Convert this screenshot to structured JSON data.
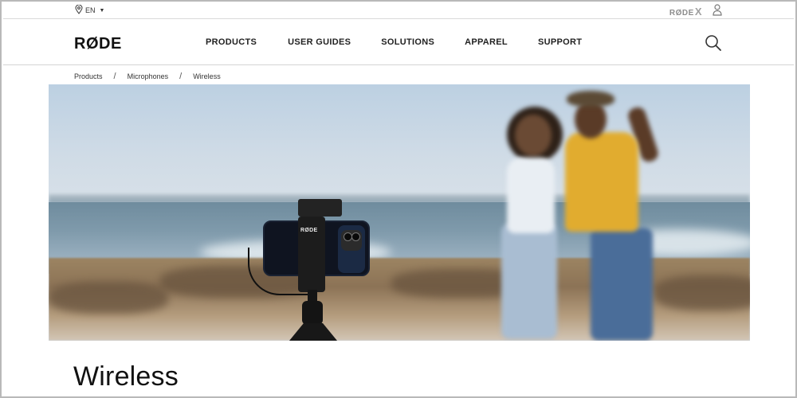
{
  "utility_bar": {
    "language": "EN",
    "rodex_label": "RØDE",
    "rodex_suffix": "X"
  },
  "brand": {
    "logo": "RØDE"
  },
  "nav": {
    "items": [
      {
        "label": "PRODUCTS"
      },
      {
        "label": "USER GUIDES"
      },
      {
        "label": "SOLUTIONS"
      },
      {
        "label": "APPAREL"
      },
      {
        "label": "SUPPORT"
      }
    ]
  },
  "breadcrumb": {
    "items": [
      {
        "label": "Products"
      },
      {
        "label": "Microphones"
      },
      {
        "label": "Wireless"
      }
    ],
    "separator": "/"
  },
  "hero": {
    "device_brand": "RØDE"
  },
  "page": {
    "title": "Wireless"
  },
  "icons": {
    "location": "location-pin-icon",
    "caret": "chevron-down-icon",
    "user": "user-icon",
    "search": "search-icon"
  },
  "colors": {
    "text": "#222222",
    "border": "#d4d4d4",
    "muted": "#8c8c8c"
  }
}
